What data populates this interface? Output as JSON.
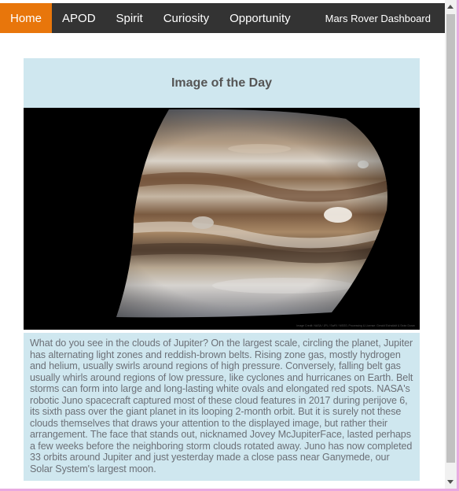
{
  "nav": {
    "items": [
      {
        "label": "Home",
        "active": true
      },
      {
        "label": "APOD",
        "active": false
      },
      {
        "label": "Spirit",
        "active": false
      },
      {
        "label": "Curiosity",
        "active": false
      },
      {
        "label": "Opportunity",
        "active": false
      }
    ],
    "brand": "Mars Rover Dashboard"
  },
  "card": {
    "title": "Image of the Day",
    "image_credit": "Image Credit: NASA / JPL / SwRI / MSSS; Processing & License: Gerald Eichstädt & Seán Doran",
    "caption": "What do you see in the clouds of Jupiter? On the largest scale, circling the planet, Jupiter has alternating light zones and reddish-brown belts. Rising zone gas, mostly hydrogen and helium, usually swirls around regions of high pressure. Conversely, falling belt gas usually whirls around regions of low pressure, like cyclones and hurricanes on Earth. Belt storms can form into large and long-lasting white ovals and elongated red spots. NASA's robotic Juno spacecraft captured most of these cloud features in 2017 during perijove 6, its sixth pass over the giant planet in its looping 2-month orbit. But it is surely not these clouds themselves that draws your attention to the displayed image, but rather their arrangement. The face that stands out, nicknamed Jovey McJupiterFace, lasted perhaps a few weeks before the neighboring storm clouds rotated away. Juno has now completed 33 orbits around Jupiter and just yesterday made a close pass near Ganymede, our Solar System's largest moon."
  },
  "colors": {
    "accent": "#e8760b",
    "navbar": "#333333",
    "panel": "#cfe7ef"
  }
}
